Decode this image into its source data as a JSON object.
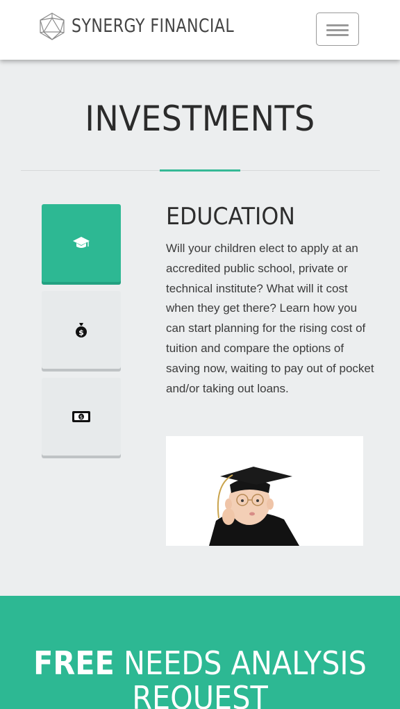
{
  "header": {
    "brand": "SYNERGY FINANCIAL",
    "logo_icon": "icosahedron-logo-icon",
    "menu_icon": "hamburger-menu-icon"
  },
  "section": {
    "title": "INVESTMENTS",
    "accent_color": "#35b996"
  },
  "tabs": [
    {
      "name": "education",
      "icon": "graduation-cap-icon",
      "active": true
    },
    {
      "name": "savings",
      "icon": "money-bag-icon",
      "active": false
    },
    {
      "name": "cash",
      "icon": "banknote-icon",
      "active": false
    }
  ],
  "content": {
    "title": "EDUCATION",
    "body": "Will your children elect to apply at an accredited public school, private or technical institute? What will it cost when they get there? Learn how you can start planning for the rising cost of tuition and compare the options of saving now, waiting to pay out of pocket and/or taking out loans.",
    "image_subject": "baby-in-graduation-cap-photo"
  },
  "cta": {
    "bold": "FREE",
    "rest": " NEEDS ANALYSIS REQUEST",
    "background_color": "#2db893"
  }
}
